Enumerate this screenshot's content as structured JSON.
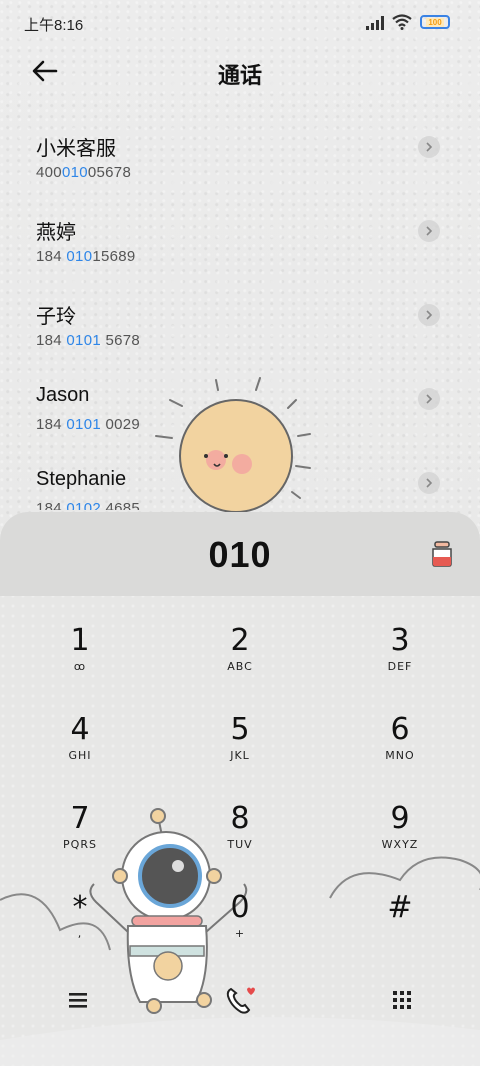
{
  "status_bar": {
    "time": "上午8:16",
    "battery": "100"
  },
  "header": {
    "title": "通话"
  },
  "contacts": [
    {
      "name": "小米客服",
      "number_pre": "400",
      "number_hl": "010",
      "number_post": "05678"
    },
    {
      "name": "燕婷",
      "number_pre": "184 ",
      "number_hl": "010",
      "number_post": "15689"
    },
    {
      "name": "子玲",
      "number_pre": "184 ",
      "number_hl": "0101",
      "number_post": " 5678"
    },
    {
      "name": "Jason",
      "number_pre": "184 ",
      "number_hl": "0101",
      "number_post": " 0029"
    },
    {
      "name": "Stephanie",
      "number_pre": "184 ",
      "number_hl": "0102",
      "number_post": " 4685"
    }
  ],
  "dialer": {
    "typed": "010",
    "keys": [
      {
        "digit": "1",
        "letters": "ꝏ"
      },
      {
        "digit": "2",
        "letters": "ABC"
      },
      {
        "digit": "3",
        "letters": "DEF"
      },
      {
        "digit": "4",
        "letters": "GHI"
      },
      {
        "digit": "5",
        "letters": "JKL"
      },
      {
        "digit": "6",
        "letters": "MNO"
      },
      {
        "digit": "7",
        "letters": "PQRS"
      },
      {
        "digit": "8",
        "letters": "TUV"
      },
      {
        "digit": "9",
        "letters": "WXYZ"
      },
      {
        "digit": "*",
        "letters": ","
      },
      {
        "digit": "0",
        "letters": "+"
      },
      {
        "digit": "#",
        "letters": ""
      }
    ]
  },
  "colors": {
    "highlight": "#2f86e8",
    "battery_border": "#3a83e5",
    "call_heart": "#e64b4b"
  },
  "icons": {
    "back": "arrow-left-icon",
    "delete": "backspace-jar-icon",
    "menu": "menu-icon",
    "call": "phone-call-icon",
    "keypad": "keypad-icon"
  }
}
